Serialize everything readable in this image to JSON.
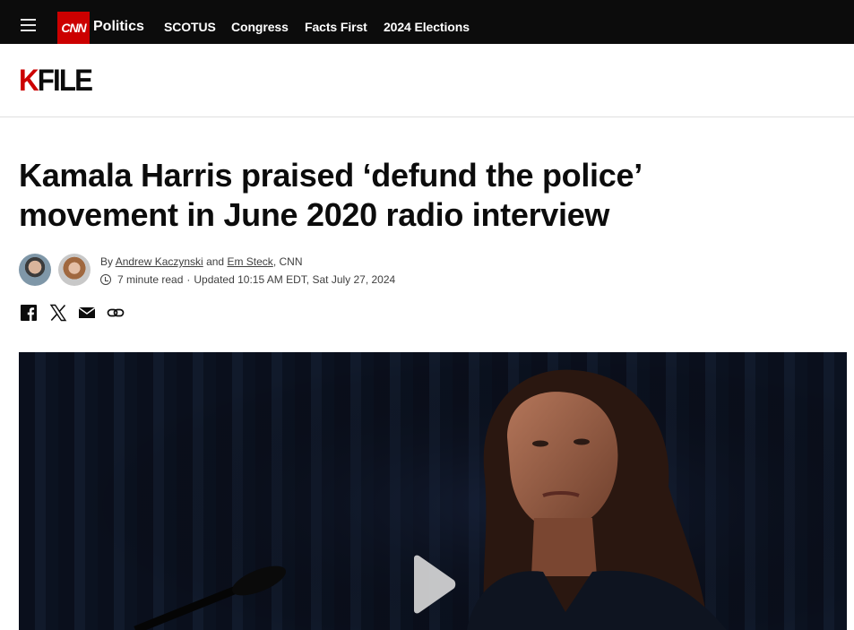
{
  "nav": {
    "logo": "CNN",
    "section": "Politics",
    "links": [
      "SCOTUS",
      "Congress",
      "Facts First",
      "2024 Elections"
    ]
  },
  "kfile": {
    "k": "K",
    "rest": "FILE"
  },
  "article": {
    "headline": "Kamala Harris praised ‘defund the police’ movement in June 2020 radio interview",
    "byline": {
      "by": "By",
      "author1": "Andrew Kaczynski",
      "and": "and",
      "author2": "Em Steck",
      "outlet": ", CNN"
    },
    "read_time": "7 minute read",
    "separator": "·",
    "updated": "Updated 10:15 AM EDT, Sat July 27, 2024"
  },
  "share_icons": [
    "facebook-icon",
    "x-icon",
    "email-icon",
    "link-icon"
  ],
  "hero": {
    "media": "video",
    "play_icon": "play-icon"
  },
  "colors": {
    "brand_red": "#cc0000",
    "nav_bg": "#0c0c0c",
    "text": "#0c0c0c"
  }
}
